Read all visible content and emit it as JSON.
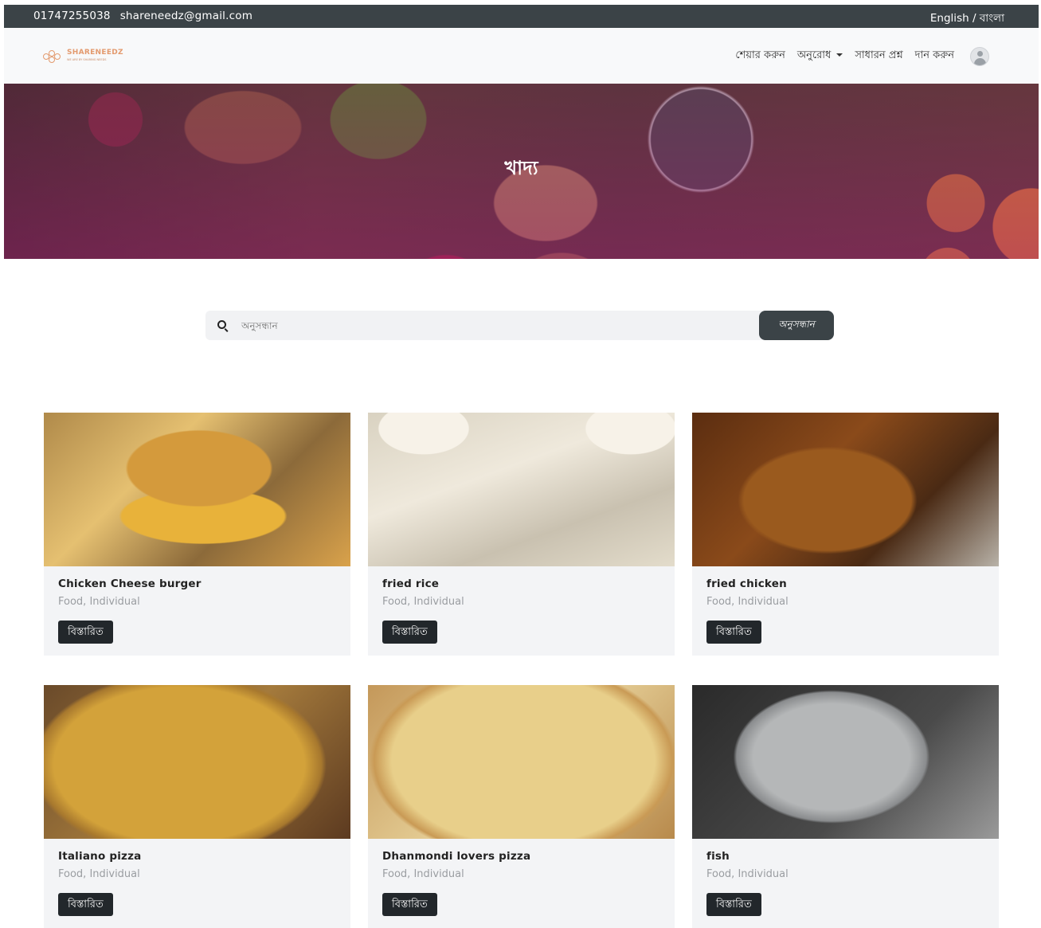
{
  "topbar": {
    "phone": "01747255038",
    "email": "shareneedz@gmail.com",
    "language": "English / বাংলা"
  },
  "logo": {
    "name": "SHARENEEDZ",
    "tagline": "WE ARE BY SHARING NEEDS"
  },
  "nav": {
    "share": "শেয়ার করুন",
    "request": "অনুরোধ",
    "faq": "সাধারন প্রশ্ন",
    "donate": "দান করুন"
  },
  "hero": {
    "title": "খাদ্য"
  },
  "search": {
    "placeholder": "অনুসন্ধান",
    "button": "অনুসন্ধান"
  },
  "items": [
    {
      "title": "Chicken Cheese burger",
      "meta": "Food, Individual",
      "button": "বিস্তারিত"
    },
    {
      "title": "fried rice",
      "meta": "Food, Individual",
      "button": "বিস্তারিত"
    },
    {
      "title": "fried chicken",
      "meta": "Food, Individual",
      "button": "বিস্তারিত"
    },
    {
      "title": "Italiano pizza",
      "meta": "Food, Individual",
      "button": "বিস্তারিত"
    },
    {
      "title": "Dhanmondi lovers pizza",
      "meta": "Food, Individual",
      "button": "বিস্তারিত"
    },
    {
      "title": "fish",
      "meta": "Food, Individual",
      "button": "বিস্তারিত"
    }
  ],
  "colors": {
    "topbar": "#3b4347",
    "button": "#22272b",
    "accent": "#e39a6e"
  }
}
